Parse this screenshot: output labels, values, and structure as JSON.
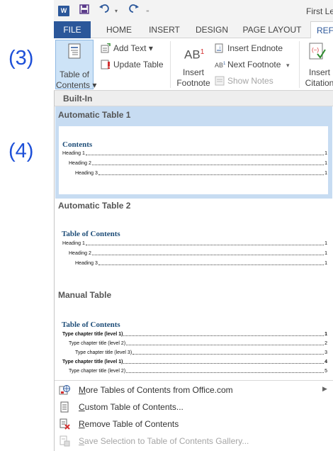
{
  "annotations": {
    "step3": "(3)",
    "step4": "(4)"
  },
  "titlebar": {
    "app_icon": "W",
    "doc_title": "First Lev"
  },
  "tabs": [
    "FILE",
    "HOME",
    "INSERT",
    "DESIGN",
    "PAGE LAYOUT",
    "REFE"
  ],
  "ribbon": {
    "toc_line1": "Table of",
    "toc_line2": "Contents",
    "add_text": "Add Text",
    "update_table": "Update Table",
    "insert_line1": "Insert",
    "insert_line2": "Footnote",
    "insert_endnote": "Insert Endnote",
    "next_footnote": "Next Footnote",
    "show_notes": "Show Notes",
    "citation_line1": "Insert",
    "citation_line2": "Citation"
  },
  "gallery": {
    "section_header": "Built-In",
    "auto1": {
      "title": "Automatic Table 1",
      "heading": "Contents",
      "lines": [
        {
          "text": "Heading 1",
          "page": "1"
        },
        {
          "text": "Heading 2",
          "page": "1"
        },
        {
          "text": "Heading 3",
          "page": "1"
        }
      ]
    },
    "auto2": {
      "title": "Automatic Table 2",
      "heading": "Table of Contents",
      "lines": [
        {
          "text": "Heading 1",
          "page": "1"
        },
        {
          "text": "Heading 2",
          "page": "1"
        },
        {
          "text": "Heading 3",
          "page": "1"
        }
      ]
    },
    "manual": {
      "title": "Manual Table",
      "heading": "Table of Contents",
      "lines": [
        {
          "text": "Type chapter title (level 1)",
          "page": "1"
        },
        {
          "text": "Type chapter title (level 2)",
          "page": "2"
        },
        {
          "text": "Type chapter title (level 3)",
          "page": "3"
        },
        {
          "text": "Type chapter title (level 1)",
          "page": "4"
        },
        {
          "text": "Type chapter title (level 2)",
          "page": "5"
        }
      ]
    }
  },
  "menu": [
    {
      "mnemonic": "M",
      "rest": "ore Tables of Contents from Office.com",
      "icon": "office-web-icon",
      "submenu": true,
      "disabled": false
    },
    {
      "mnemonic": "C",
      "rest": "ustom Table of Contents...",
      "icon": "document-icon",
      "submenu": false,
      "disabled": false
    },
    {
      "mnemonic": "R",
      "rest": "emove Table of Contents",
      "icon": "remove-document-icon",
      "submenu": false,
      "disabled": false
    },
    {
      "mnemonic": "S",
      "rest": "ave Selection to Table of Contents Gallery...",
      "icon": "save-gallery-icon",
      "submenu": false,
      "disabled": true
    }
  ],
  "colors": {
    "accent": "#2b579a",
    "annotation": "#1e50d8",
    "selected": "#c7dcf2",
    "toc_heading": "#1f4e79"
  }
}
